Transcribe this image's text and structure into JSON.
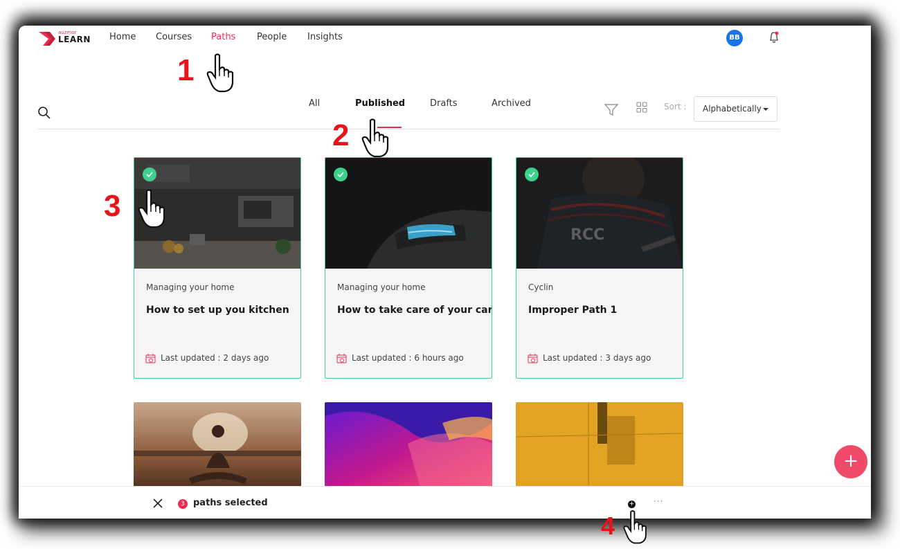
{
  "brand": {
    "small": "auzmor",
    "big": "LEARN",
    "color": "#ec2d52"
  },
  "nav": {
    "items": [
      {
        "label": "Home",
        "active": false
      },
      {
        "label": "Courses",
        "active": false
      },
      {
        "label": "Paths",
        "active": true
      },
      {
        "label": "People",
        "active": false
      },
      {
        "label": "Insights",
        "active": false
      }
    ],
    "avatar_initials": "BB"
  },
  "tabs": [
    {
      "label": "All",
      "active": false
    },
    {
      "label": "Published",
      "active": true
    },
    {
      "label": "Drafts",
      "active": false
    },
    {
      "label": "Archived",
      "active": false
    }
  ],
  "sort": {
    "label": "Sort :",
    "value": "Alphabetically"
  },
  "cards": [
    {
      "category": "Managing your home",
      "title": "How to set up you kitchen",
      "updated": "Last updated : 2 days ago",
      "selected": true,
      "image": "kitchen"
    },
    {
      "category": "Managing your home",
      "title": "How to take care of your car",
      "updated": "Last updated : 6 hours ago",
      "selected": true,
      "image": "car"
    },
    {
      "category": "Cyclin",
      "title": "Improper Path 1",
      "updated": "Last updated : 3 days ago",
      "selected": true,
      "image": "cyclist"
    }
  ],
  "more_cards": [
    {
      "image": "yoga"
    },
    {
      "image": "gradient"
    },
    {
      "image": "yellow-wall"
    }
  ],
  "selection_bar": {
    "count": "3",
    "text": "paths selected",
    "more": "···"
  },
  "annotations": [
    "1",
    "2",
    "3",
    "4"
  ],
  "colors": {
    "accent": "#ec2d52",
    "selected_border": "#3fcf8e",
    "avatar": "#1a73e8",
    "fab": "#ef4a68"
  }
}
